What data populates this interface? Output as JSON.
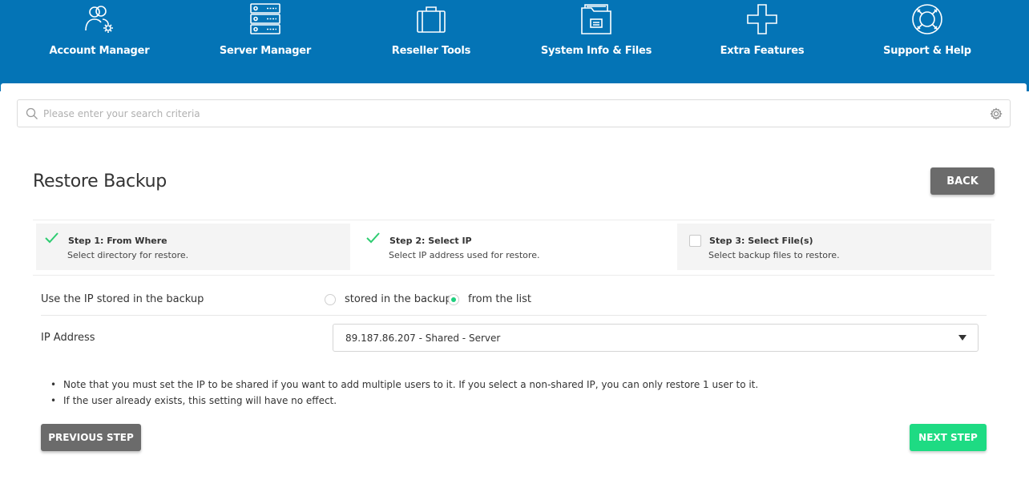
{
  "nav": {
    "items": [
      {
        "label": "Account Manager",
        "icon": "users-gear-icon"
      },
      {
        "label": "Server Manager",
        "icon": "server-icon"
      },
      {
        "label": "Reseller Tools",
        "icon": "briefcase-icon"
      },
      {
        "label": "System Info & Files",
        "icon": "folder-icon"
      },
      {
        "label": "Extra Features",
        "icon": "plus-icon"
      },
      {
        "label": "Support & Help",
        "icon": "lifebuoy-icon"
      }
    ]
  },
  "search": {
    "placeholder": "Please enter your search criteria",
    "value": ""
  },
  "page": {
    "title": "Restore Backup",
    "back_label": "BACK"
  },
  "steps": [
    {
      "title": "Step 1: From Where",
      "description": "Select directory for restore.",
      "status": "done"
    },
    {
      "title": "Step 2: Select IP",
      "description": "Select IP address used for restore.",
      "status": "current"
    },
    {
      "title": "Step 3: Select File(s)",
      "description": "Select backup files to restore.",
      "status": "todo"
    }
  ],
  "form": {
    "ip_source_label": "Use the IP stored in the backup",
    "ip_source_options": [
      {
        "label": "stored in the backup",
        "checked": false
      },
      {
        "label": "from the list",
        "checked": true
      }
    ],
    "ip_address_label": "IP Address",
    "ip_address_value": "89.187.86.207 - Shared - Server"
  },
  "notes": [
    "Note that you must set the IP to be shared if you want to add multiple users to it. If you select a non-shared IP, you can only restore 1 user to it.",
    "If the user already exists, this setting will have no effect."
  ],
  "actions": {
    "previous_label": "PREVIOUS STEP",
    "next_label": "NEXT STEP"
  },
  "colors": {
    "header": "#0474b6",
    "accent_green": "#1edb83",
    "button_gray": "#6b6b6b",
    "check_green": "#2ecc71"
  }
}
